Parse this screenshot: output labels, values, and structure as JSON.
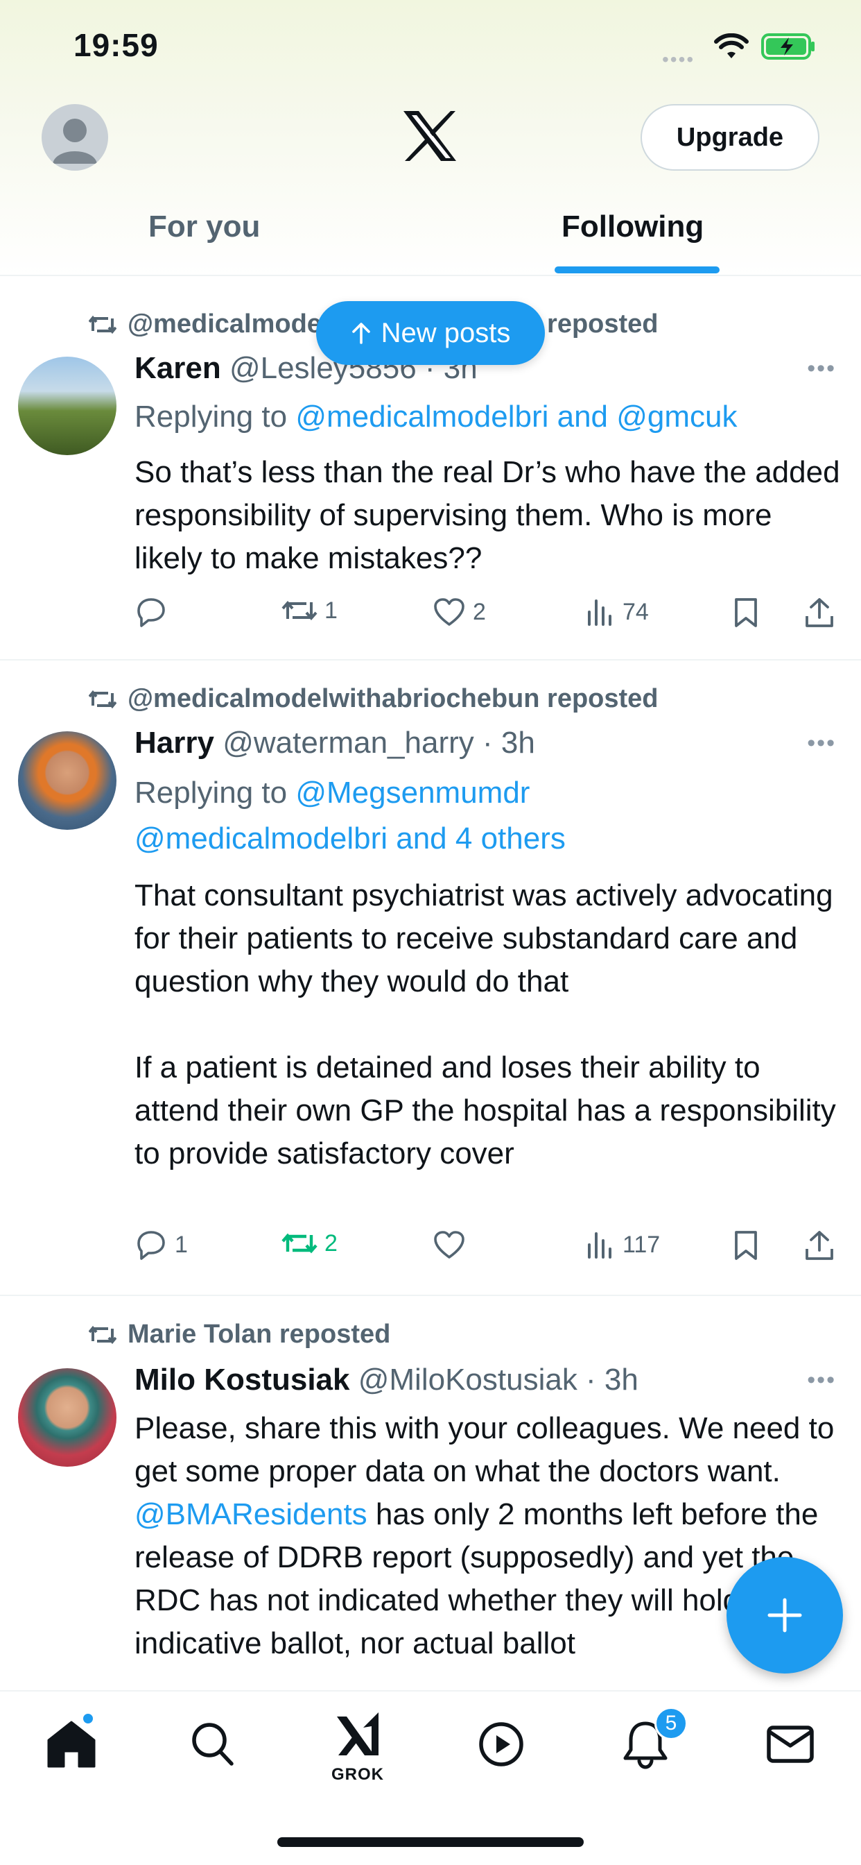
{
  "status_bar": {
    "time": "19:59",
    "signal_dots": "••••"
  },
  "header": {
    "upgrade_label": "Upgrade"
  },
  "tabs": [
    {
      "label": "For you",
      "selected": false
    },
    {
      "label": "Following",
      "selected": true
    }
  ],
  "new_posts_label": "New posts",
  "posts": [
    {
      "reposted_by": "@medicalmodelwithabriochebun reposted",
      "name": "Karen",
      "meta": "@Lesley5856 · 3h",
      "reply_prefix": "Replying to ",
      "reply_targets": "@medicalmodelbri and @gmcuk",
      "text": "So that’s less than the real Dr’s who have the added responsibility of supervising them. Who is more likely to make mistakes??",
      "replies": "",
      "reposts": "1",
      "likes": "2",
      "views": "74"
    },
    {
      "reposted_by": "@medicalmodelwithabriochebun reposted",
      "name": "Harry",
      "meta": "@waterman_harry · 3h",
      "reply_prefix": "Replying to ",
      "reply_targets_line1": "@Megsenmumdr",
      "reply_targets_line2": "@medicalmodelbri and 4 others",
      "text_p1": "That consultant psychiatrist was actively advocating for their patients to receive substandard care and question why they would do that",
      "text_p2": "If a patient is detained and loses their ability to attend their own GP the hospital has a responsibility to provide satisfactory cover",
      "replies": "1",
      "reposts": "2",
      "likes": "",
      "views": "117"
    },
    {
      "reposted_by": "Marie Tolan reposted",
      "name": "Milo Kostusiak",
      "meta": "@MiloKostusiak · 3h",
      "text_before": "Please, share this with your colleagues. We need to get some proper data on what the doctors want. ",
      "mention": "@BMAResidents",
      "text_after": " has only 2 months left before the release of DDRB report (supposedly) and yet the RDC has not indicated whether they will hold indicative ballot, nor actual ballot"
    }
  ],
  "bottom_nav": {
    "grok_label": "GROK",
    "notification_count": "5"
  },
  "colors": {
    "accent": "#1d9bf0",
    "repost_green": "#00ba7c",
    "secondary_text": "#536471"
  }
}
